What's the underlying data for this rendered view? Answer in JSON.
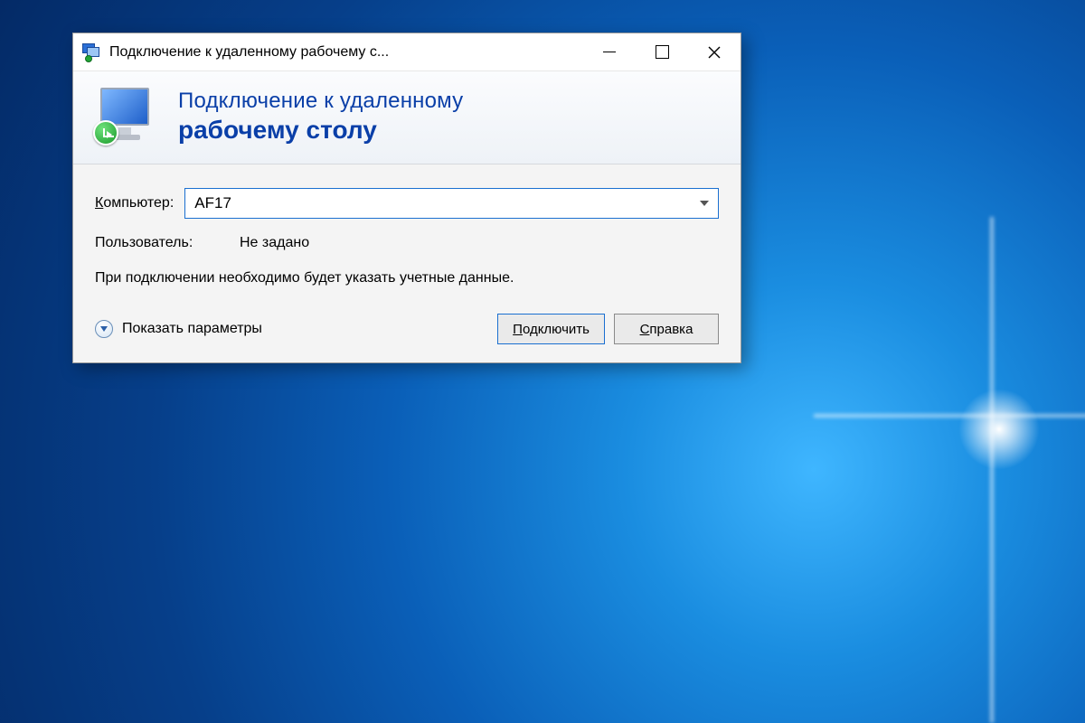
{
  "window": {
    "title": "Подключение к удаленному рабочему с..."
  },
  "banner": {
    "line1": "Подключение к удаленному",
    "line2": "рабочему столу"
  },
  "form": {
    "computer_label_prefix": "К",
    "computer_label_rest": "омпьютер:",
    "computer_value": "AF17",
    "user_label": "Пользователь:",
    "user_value": "Не задано",
    "info_text": "При подключении необходимо будет указать учетные данные."
  },
  "footer": {
    "show_options_prefix": "П",
    "show_options_rest": "оказать параметры",
    "connect_prefix": "П",
    "connect_rest": "одключить",
    "help_prefix": "С",
    "help_rest": "правка"
  }
}
